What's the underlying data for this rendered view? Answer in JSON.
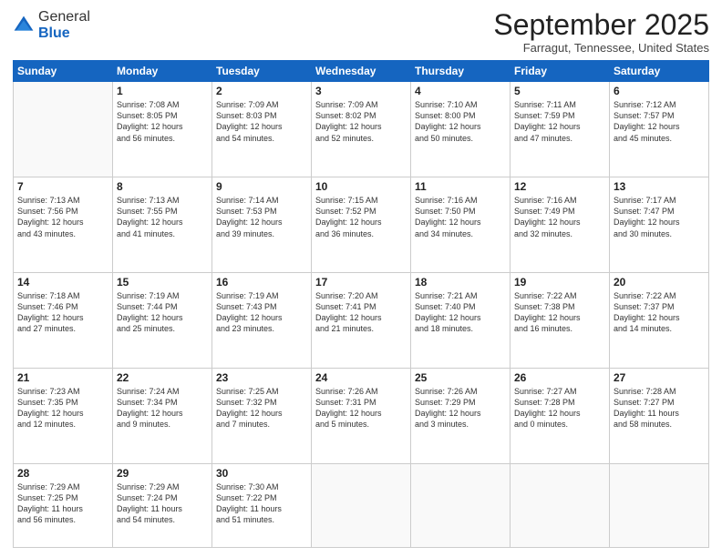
{
  "logo": {
    "general": "General",
    "blue": "Blue"
  },
  "title": "September 2025",
  "subtitle": "Farragut, Tennessee, United States",
  "days_of_week": [
    "Sunday",
    "Monday",
    "Tuesday",
    "Wednesday",
    "Thursday",
    "Friday",
    "Saturday"
  ],
  "weeks": [
    [
      {
        "day": "",
        "info": ""
      },
      {
        "day": "1",
        "info": "Sunrise: 7:08 AM\nSunset: 8:05 PM\nDaylight: 12 hours\nand 56 minutes."
      },
      {
        "day": "2",
        "info": "Sunrise: 7:09 AM\nSunset: 8:03 PM\nDaylight: 12 hours\nand 54 minutes."
      },
      {
        "day": "3",
        "info": "Sunrise: 7:09 AM\nSunset: 8:02 PM\nDaylight: 12 hours\nand 52 minutes."
      },
      {
        "day": "4",
        "info": "Sunrise: 7:10 AM\nSunset: 8:00 PM\nDaylight: 12 hours\nand 50 minutes."
      },
      {
        "day": "5",
        "info": "Sunrise: 7:11 AM\nSunset: 7:59 PM\nDaylight: 12 hours\nand 47 minutes."
      },
      {
        "day": "6",
        "info": "Sunrise: 7:12 AM\nSunset: 7:57 PM\nDaylight: 12 hours\nand 45 minutes."
      }
    ],
    [
      {
        "day": "7",
        "info": "Sunrise: 7:13 AM\nSunset: 7:56 PM\nDaylight: 12 hours\nand 43 minutes."
      },
      {
        "day": "8",
        "info": "Sunrise: 7:13 AM\nSunset: 7:55 PM\nDaylight: 12 hours\nand 41 minutes."
      },
      {
        "day": "9",
        "info": "Sunrise: 7:14 AM\nSunset: 7:53 PM\nDaylight: 12 hours\nand 39 minutes."
      },
      {
        "day": "10",
        "info": "Sunrise: 7:15 AM\nSunset: 7:52 PM\nDaylight: 12 hours\nand 36 minutes."
      },
      {
        "day": "11",
        "info": "Sunrise: 7:16 AM\nSunset: 7:50 PM\nDaylight: 12 hours\nand 34 minutes."
      },
      {
        "day": "12",
        "info": "Sunrise: 7:16 AM\nSunset: 7:49 PM\nDaylight: 12 hours\nand 32 minutes."
      },
      {
        "day": "13",
        "info": "Sunrise: 7:17 AM\nSunset: 7:47 PM\nDaylight: 12 hours\nand 30 minutes."
      }
    ],
    [
      {
        "day": "14",
        "info": "Sunrise: 7:18 AM\nSunset: 7:46 PM\nDaylight: 12 hours\nand 27 minutes."
      },
      {
        "day": "15",
        "info": "Sunrise: 7:19 AM\nSunset: 7:44 PM\nDaylight: 12 hours\nand 25 minutes."
      },
      {
        "day": "16",
        "info": "Sunrise: 7:19 AM\nSunset: 7:43 PM\nDaylight: 12 hours\nand 23 minutes."
      },
      {
        "day": "17",
        "info": "Sunrise: 7:20 AM\nSunset: 7:41 PM\nDaylight: 12 hours\nand 21 minutes."
      },
      {
        "day": "18",
        "info": "Sunrise: 7:21 AM\nSunset: 7:40 PM\nDaylight: 12 hours\nand 18 minutes."
      },
      {
        "day": "19",
        "info": "Sunrise: 7:22 AM\nSunset: 7:38 PM\nDaylight: 12 hours\nand 16 minutes."
      },
      {
        "day": "20",
        "info": "Sunrise: 7:22 AM\nSunset: 7:37 PM\nDaylight: 12 hours\nand 14 minutes."
      }
    ],
    [
      {
        "day": "21",
        "info": "Sunrise: 7:23 AM\nSunset: 7:35 PM\nDaylight: 12 hours\nand 12 minutes."
      },
      {
        "day": "22",
        "info": "Sunrise: 7:24 AM\nSunset: 7:34 PM\nDaylight: 12 hours\nand 9 minutes."
      },
      {
        "day": "23",
        "info": "Sunrise: 7:25 AM\nSunset: 7:32 PM\nDaylight: 12 hours\nand 7 minutes."
      },
      {
        "day": "24",
        "info": "Sunrise: 7:26 AM\nSunset: 7:31 PM\nDaylight: 12 hours\nand 5 minutes."
      },
      {
        "day": "25",
        "info": "Sunrise: 7:26 AM\nSunset: 7:29 PM\nDaylight: 12 hours\nand 3 minutes."
      },
      {
        "day": "26",
        "info": "Sunrise: 7:27 AM\nSunset: 7:28 PM\nDaylight: 12 hours\nand 0 minutes."
      },
      {
        "day": "27",
        "info": "Sunrise: 7:28 AM\nSunset: 7:27 PM\nDaylight: 11 hours\nand 58 minutes."
      }
    ],
    [
      {
        "day": "28",
        "info": "Sunrise: 7:29 AM\nSunset: 7:25 PM\nDaylight: 11 hours\nand 56 minutes."
      },
      {
        "day": "29",
        "info": "Sunrise: 7:29 AM\nSunset: 7:24 PM\nDaylight: 11 hours\nand 54 minutes."
      },
      {
        "day": "30",
        "info": "Sunrise: 7:30 AM\nSunset: 7:22 PM\nDaylight: 11 hours\nand 51 minutes."
      },
      {
        "day": "",
        "info": ""
      },
      {
        "day": "",
        "info": ""
      },
      {
        "day": "",
        "info": ""
      },
      {
        "day": "",
        "info": ""
      }
    ]
  ]
}
